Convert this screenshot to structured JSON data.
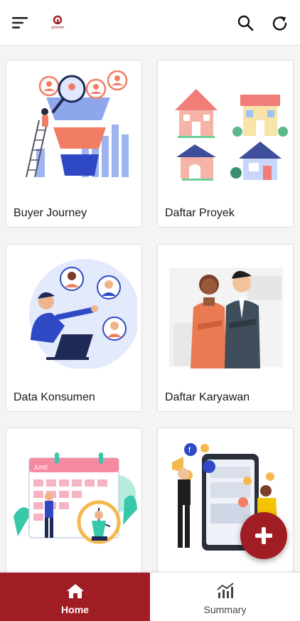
{
  "header": {
    "logo_text": "qchome",
    "menu_icon": "hamburger-menu-icon",
    "search_icon": "search-icon",
    "refresh_icon": "refresh-icon",
    "brand_color": "#a11d24"
  },
  "cards": [
    {
      "label": "Buyer Journey",
      "icon": "buyer-journey-illustration"
    },
    {
      "label": "Daftar Proyek",
      "icon": "project-houses-illustration"
    },
    {
      "label": "Data Konsumen",
      "icon": "consumer-data-illustration"
    },
    {
      "label": "Daftar Karyawan",
      "icon": "employees-illustration"
    },
    {
      "label": "",
      "icon": "calendar-schedule-illustration"
    },
    {
      "label": "",
      "icon": "social-media-illustration"
    }
  ],
  "fab": {
    "icon": "plus-icon"
  },
  "bottom_nav": {
    "active": "Home",
    "items": [
      {
        "label": "Home",
        "icon": "home-icon"
      },
      {
        "label": "Summary",
        "icon": "summary-chart-icon"
      }
    ]
  }
}
